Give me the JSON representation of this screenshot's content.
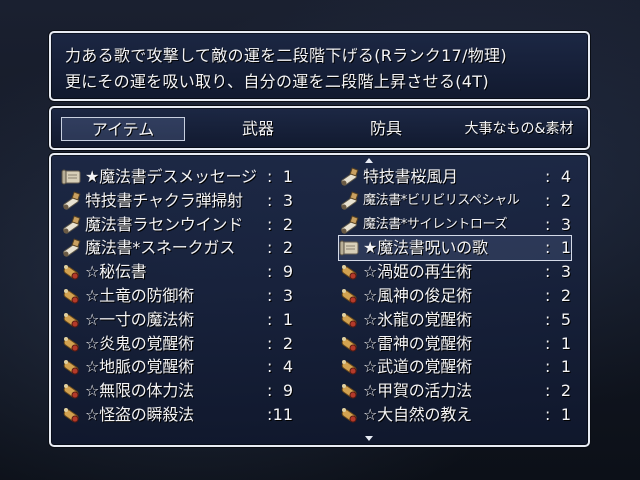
{
  "help": {
    "line1": "力ある歌で攻撃して敵の運を二段階下げる(Rランク17/物理)",
    "line2": "更にその運を吸い取り、自分の運を二段階上昇させる(4T)"
  },
  "categories": [
    "アイテム",
    "武器",
    "防具",
    "大事なもの&素材"
  ],
  "colon": ":",
  "left_items": [
    {
      "name": "★魔法書デスメッセージ",
      "count": "1",
      "icon": "scroll-icon"
    },
    {
      "name": "特技書チャクラ弾掃射",
      "count": "3",
      "icon": "skillbook-icon"
    },
    {
      "name": "魔法書ラセンウインド",
      "count": "2",
      "icon": "skillbook-icon"
    },
    {
      "name": "魔法書*スネークガス",
      "count": "2",
      "icon": "skillbook-icon"
    },
    {
      "name": "☆秘伝書",
      "count": "9",
      "icon": "secret-scroll-icon"
    },
    {
      "name": "☆土竜の防御術",
      "count": "3",
      "icon": "secret-scroll-icon"
    },
    {
      "name": "☆一寸の魔法術",
      "count": "1",
      "icon": "secret-scroll-icon"
    },
    {
      "name": "☆炎鬼の覚醒術",
      "count": "2",
      "icon": "secret-scroll-icon"
    },
    {
      "name": "☆地脈の覚醒術",
      "count": "4",
      "icon": "secret-scroll-icon"
    },
    {
      "name": "☆無限の体力法",
      "count": "9",
      "icon": "secret-scroll-icon"
    },
    {
      "name": "☆怪盗の瞬殺法",
      "count": "11",
      "icon": "secret-scroll-icon"
    }
  ],
  "right_items": [
    {
      "name": "特技書桜風月",
      "count": "4",
      "icon": "skillbook-icon"
    },
    {
      "name": "魔法書*ビリビリスペシャル",
      "count": "2",
      "icon": "skillbook-icon"
    },
    {
      "name": "魔法書*サイレントローズ",
      "count": "3",
      "icon": "skillbook-icon"
    },
    {
      "name": "★魔法書呪いの歌",
      "count": "1",
      "icon": "scroll-icon"
    },
    {
      "name": "☆渦姫の再生術",
      "count": "3",
      "icon": "secret-scroll-icon"
    },
    {
      "name": "☆風神の俊足術",
      "count": "2",
      "icon": "secret-scroll-icon"
    },
    {
      "name": "☆氷龍の覚醒術",
      "count": "5",
      "icon": "secret-scroll-icon"
    },
    {
      "name": "☆雷神の覚醒術",
      "count": "1",
      "icon": "secret-scroll-icon"
    },
    {
      "name": "☆武道の覚醒術",
      "count": "1",
      "icon": "secret-scroll-icon"
    },
    {
      "name": "☆甲賀の活力法",
      "count": "2",
      "icon": "secret-scroll-icon"
    },
    {
      "name": "☆大自然の教え",
      "count": "1",
      "icon": "secret-scroll-icon"
    }
  ],
  "selected_category": "アイテム",
  "selected_item": "★魔法書呪いの歌"
}
